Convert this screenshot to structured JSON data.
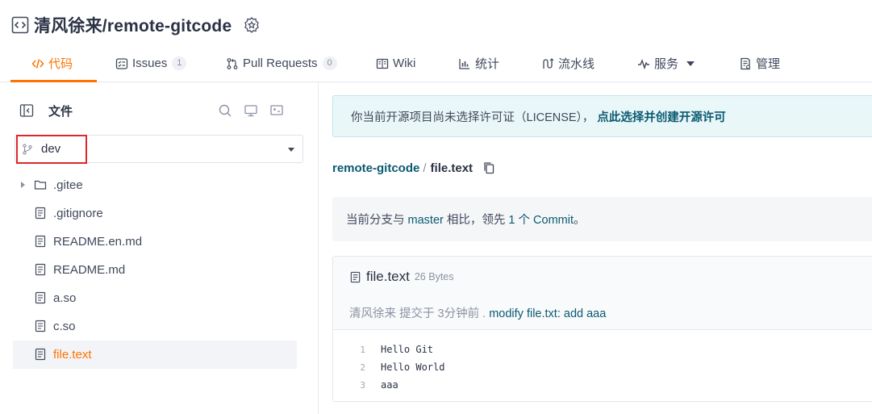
{
  "repo": {
    "name": "清风徐来/remote-gitcode"
  },
  "tabs": [
    {
      "label": "代码",
      "active": true,
      "icon": "code-icon"
    },
    {
      "label": "Issues",
      "count": "1",
      "icon": "issues-icon"
    },
    {
      "label": "Pull Requests",
      "count": "0",
      "icon": "pull-request-icon"
    },
    {
      "label": "Wiki",
      "icon": "wiki-icon"
    },
    {
      "label": "统计",
      "icon": "chart-icon"
    },
    {
      "label": "流水线",
      "icon": "pipeline-icon"
    },
    {
      "label": "服务",
      "icon": "pulse-icon",
      "dropdown": true
    },
    {
      "label": "管理",
      "icon": "settings-doc-icon"
    }
  ],
  "sidebar": {
    "title": "文件",
    "branch": "dev",
    "files": [
      {
        "name": ".gitee",
        "type": "folder"
      },
      {
        "name": ".gitignore",
        "type": "file"
      },
      {
        "name": "README.en.md",
        "type": "file"
      },
      {
        "name": "README.md",
        "type": "file"
      },
      {
        "name": "a.so",
        "type": "file"
      },
      {
        "name": "c.so",
        "type": "file"
      },
      {
        "name": "file.text",
        "type": "file",
        "active": true
      }
    ]
  },
  "license_notice": {
    "text": "你当前开源项目尚未选择许可证（LICENSE），",
    "link": "点此选择并创建开源许可"
  },
  "breadcrumb": {
    "repo": "remote-gitcode",
    "separator": "/",
    "file": "file.text"
  },
  "branch_note": {
    "prefix": "当前分支与",
    "base": "master",
    "middle": "相比，领先",
    "ahead": "1 个 Commit",
    "suffix": "。"
  },
  "file": {
    "name": "file.text",
    "size": "26 Bytes",
    "author": "清风徐来",
    "commit_meta": "提交于 3分钟前 .",
    "commit_message": "modify file.txt: add aaa",
    "lines": [
      {
        "no": "1",
        "text": "Hello Git"
      },
      {
        "no": "2",
        "text": "Hello World"
      },
      {
        "no": "3",
        "text": "aaa"
      }
    ]
  },
  "colors": {
    "accent": "#fe7300",
    "link": "#0a5a72",
    "highlight_box": "#e0262b"
  }
}
